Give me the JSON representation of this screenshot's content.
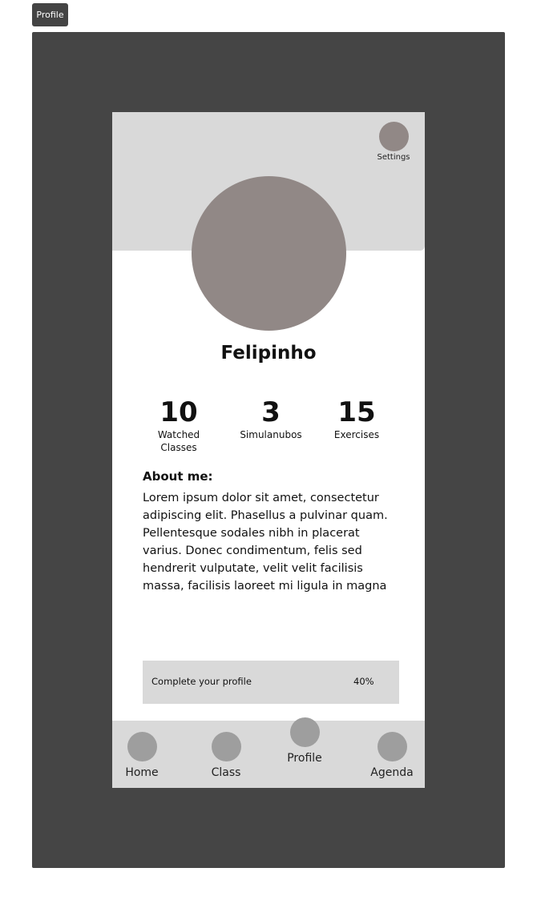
{
  "frame": {
    "tab_label": "Profile"
  },
  "header": {
    "settings_label": "Settings",
    "settings_icon": "settings-icon"
  },
  "profile": {
    "name": "Felipinho"
  },
  "stats": [
    {
      "value": "10",
      "label": "Watched Classes"
    },
    {
      "value": "3",
      "label": "Simulanubos"
    },
    {
      "value": "15",
      "label": "Exercises"
    }
  ],
  "about": {
    "title": "About me:",
    "text": "Lorem ipsum dolor sit amet, consectetur adipiscing elit. Phasellus a pulvinar quam. Pellentesque sodales nibh in placerat varius. Donec condimentum, felis sed hendrerit vulputate, velit velit facilisis massa, facilisis laoreet mi ligula in magna"
  },
  "profile_progress": {
    "label": "Complete your profile",
    "value_text": "40%",
    "percent": 40
  },
  "nav": {
    "items": [
      {
        "label": "Home",
        "icon": "home-icon"
      },
      {
        "label": "Class",
        "icon": "class-icon"
      },
      {
        "label": "Profile",
        "icon": "profile-icon",
        "active": true
      },
      {
        "label": "Agenda",
        "icon": "agenda-icon"
      }
    ]
  },
  "colors": {
    "frame": "#454545",
    "header": "#d9d9d9",
    "avatar": "#918886",
    "nav_icon": "#9e9e9e"
  }
}
